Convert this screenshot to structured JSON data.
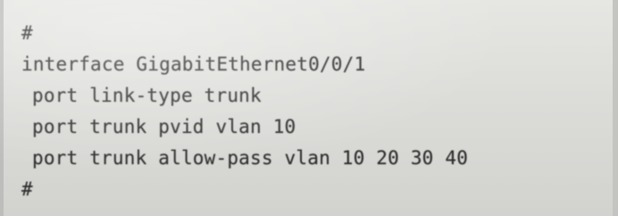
{
  "config_lines": [
    {
      "text": "#",
      "indent": false
    },
    {
      "text": "interface GigabitEthernet0/0/1",
      "indent": false
    },
    {
      "text": "port link-type trunk",
      "indent": true
    },
    {
      "text": "port trunk pvid vlan 10",
      "indent": true
    },
    {
      "text": "port trunk allow-pass vlan 10 20 30 40",
      "indent": true
    },
    {
      "text": "#",
      "indent": false
    }
  ],
  "colors": {
    "text": "#2e2e2e",
    "background": "#dcdcd9"
  }
}
